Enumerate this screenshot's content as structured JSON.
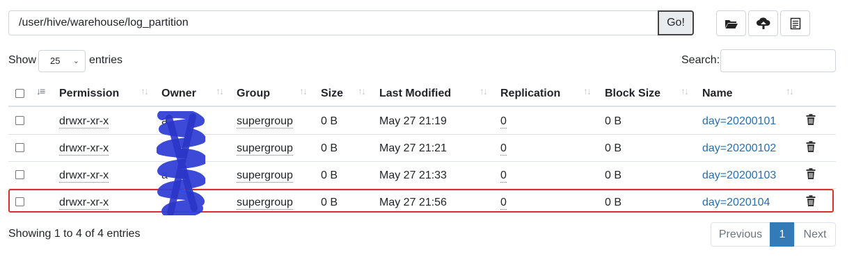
{
  "toolbar": {
    "path_value": "/user/hive/warehouse/log_partition",
    "go_label": "Go!",
    "icons": [
      "folder-open-icon",
      "cloud-upload-icon",
      "list-icon"
    ]
  },
  "length": {
    "show_label": "Show",
    "selected": "25",
    "entries_label": "entries"
  },
  "search": {
    "label": "Search:",
    "value": ""
  },
  "table": {
    "headers": [
      "Permission",
      "Owner",
      "Group",
      "Size",
      "Last Modified",
      "Replication",
      "Block Size",
      "Name"
    ],
    "rows": [
      {
        "permission": "drwxr-xr-x",
        "owner": "a",
        "group": "supergroup",
        "size": "0 B",
        "modified": "May 27 21:19",
        "replication": "0",
        "block_size": "0 B",
        "name": "day=20200101"
      },
      {
        "permission": "drwxr-xr-x",
        "owner": "",
        "group": "supergroup",
        "size": "0 B",
        "modified": "May 27 21:21",
        "replication": "0",
        "block_size": "0 B",
        "name": "day=20200102"
      },
      {
        "permission": "drwxr-xr-x",
        "owner": "a",
        "group": "supergroup",
        "size": "0 B",
        "modified": "May 27 21:33",
        "replication": "0",
        "block_size": "0 B",
        "name": "day=20200103"
      },
      {
        "permission": "drwxr-xr-x",
        "owner": "",
        "group": "supergroup",
        "size": "0 B",
        "modified": "May 27 21:56",
        "replication": "0",
        "block_size": "0 B",
        "name": "day=2020104"
      }
    ]
  },
  "footer": {
    "info": "Showing 1 to 4 of 4 entries",
    "previous": "Previous",
    "page": "1",
    "next": "Next"
  },
  "colors": {
    "accent": "#337ab7",
    "link": "#2a6faa",
    "highlight": "#d9302c",
    "scribble": "#3340d6"
  }
}
